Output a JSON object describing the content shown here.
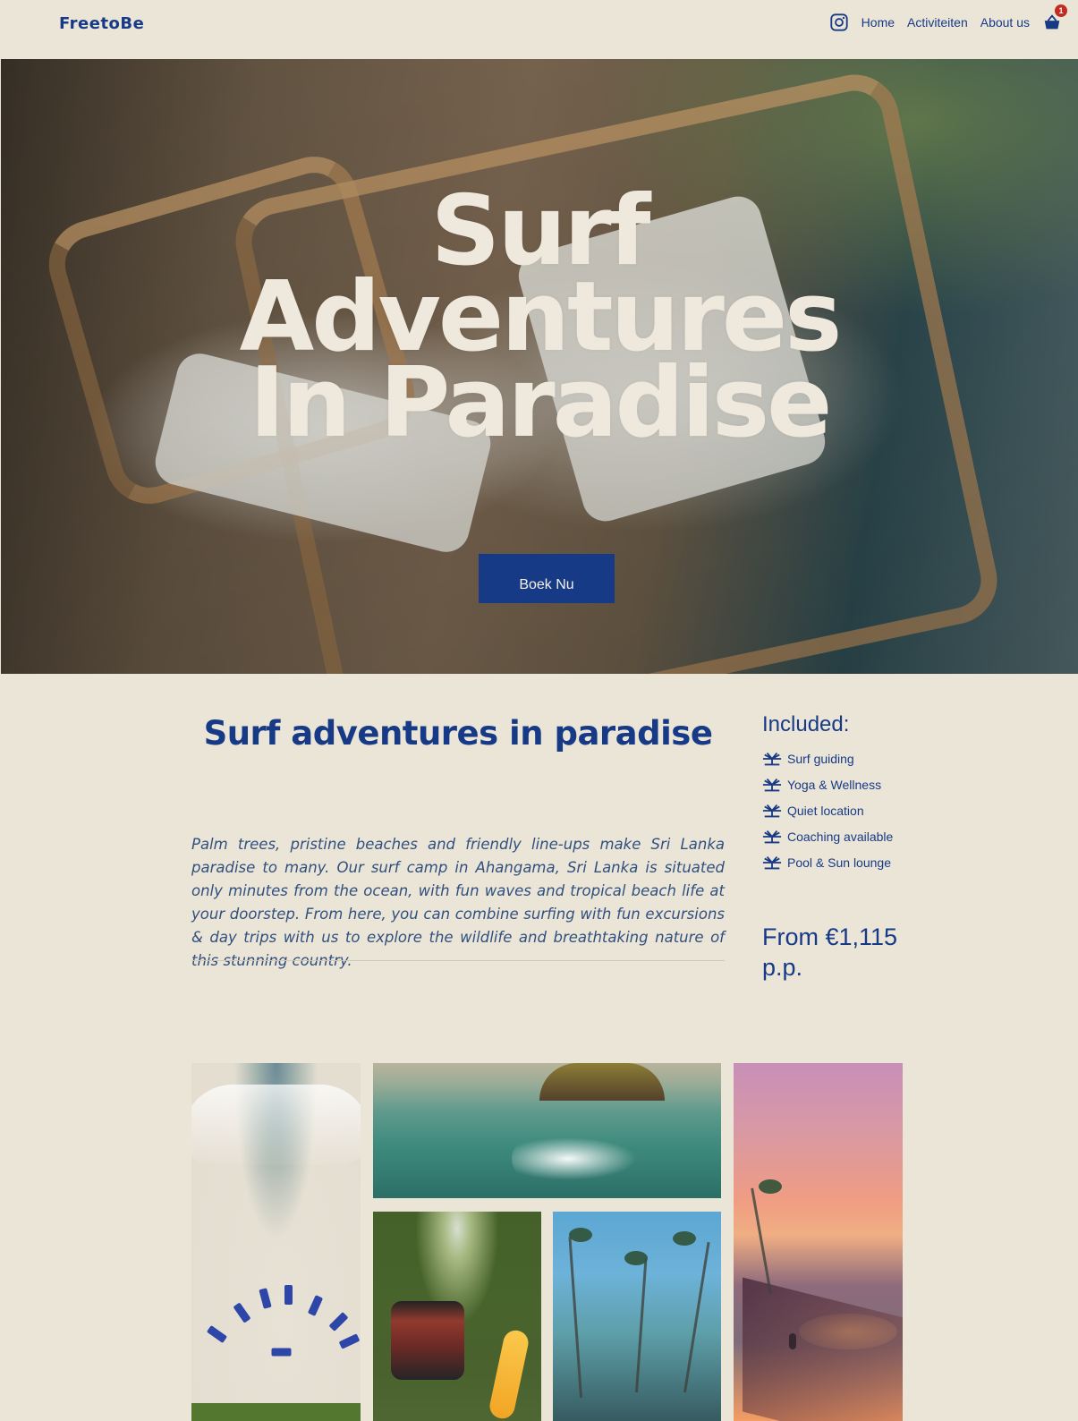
{
  "header": {
    "logo": "FreetoBe",
    "nav": [
      {
        "label": "Home"
      },
      {
        "label": "Activiteiten"
      },
      {
        "label": "About us"
      }
    ],
    "cart_count": "1"
  },
  "hero": {
    "title_lines": [
      "Surf",
      "Adventures",
      "In Paradise"
    ],
    "button_label": "Boek Nu"
  },
  "intro": {
    "title": "Surf adventures in paradise",
    "body": "Palm trees, pristine beaches and friendly line-ups make Sri Lanka paradise to many. Our surf camp in Ahangama, Sri Lanka is situated only minutes from the ocean, with fun waves and tropical beach life at your doorstep. From here, you can combine surfing with fun excursions & day trips with us to explore the wildlife and breathtaking nature of this stunning country."
  },
  "included": {
    "title": "Included:",
    "items": [
      {
        "label": "Surf guiding",
        "icon": "palm-icon"
      },
      {
        "label": "Yoga & Wellness",
        "icon": "palm-icon"
      },
      {
        "label": "Quiet location",
        "icon": "palm-icon"
      },
      {
        "label": "Coaching available",
        "icon": "palm-icon"
      },
      {
        "label": "Pool & Sun lounge",
        "icon": "palm-icon"
      }
    ],
    "price": "From €1,115 p.p."
  },
  "colors": {
    "brand_blue": "#173a86",
    "background": "#ebe5d7",
    "badge_red": "#c32a21"
  }
}
